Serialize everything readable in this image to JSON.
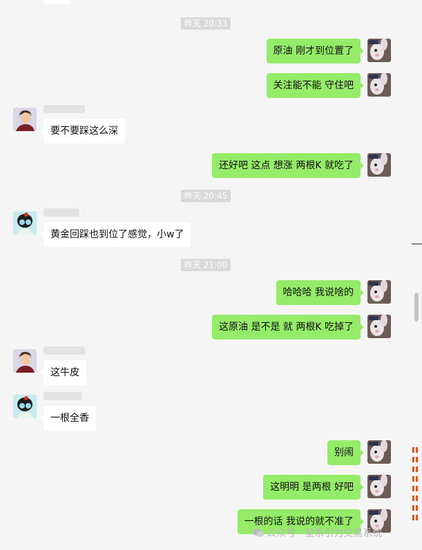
{
  "watermark": "公众号 · 星系引力交易系统",
  "timestamps": [
    "昨天 20:33",
    "昨天 20:45",
    "昨天 21:00"
  ],
  "messages": [
    "原油 刚才到位置了",
    "关注能不能 守住吧",
    "要不要踩这么深",
    "还好吧  这点 想涨 两根K 就吃了",
    "黄金回踩也到位了感觉，小w了",
    "哈哈哈 我说啥的",
    "这原油  是不是 就 两根K 吃掉了",
    "这牛皮",
    "一根全香",
    "别闹",
    "这明明 是两根 好吧",
    "一根的话  我说的就不准了"
  ],
  "colors": {
    "background": "#f5f5f5",
    "self_bubble": "#95ec69",
    "other_bubble": "#ffffff",
    "timestamp_bg": "#dadada"
  }
}
